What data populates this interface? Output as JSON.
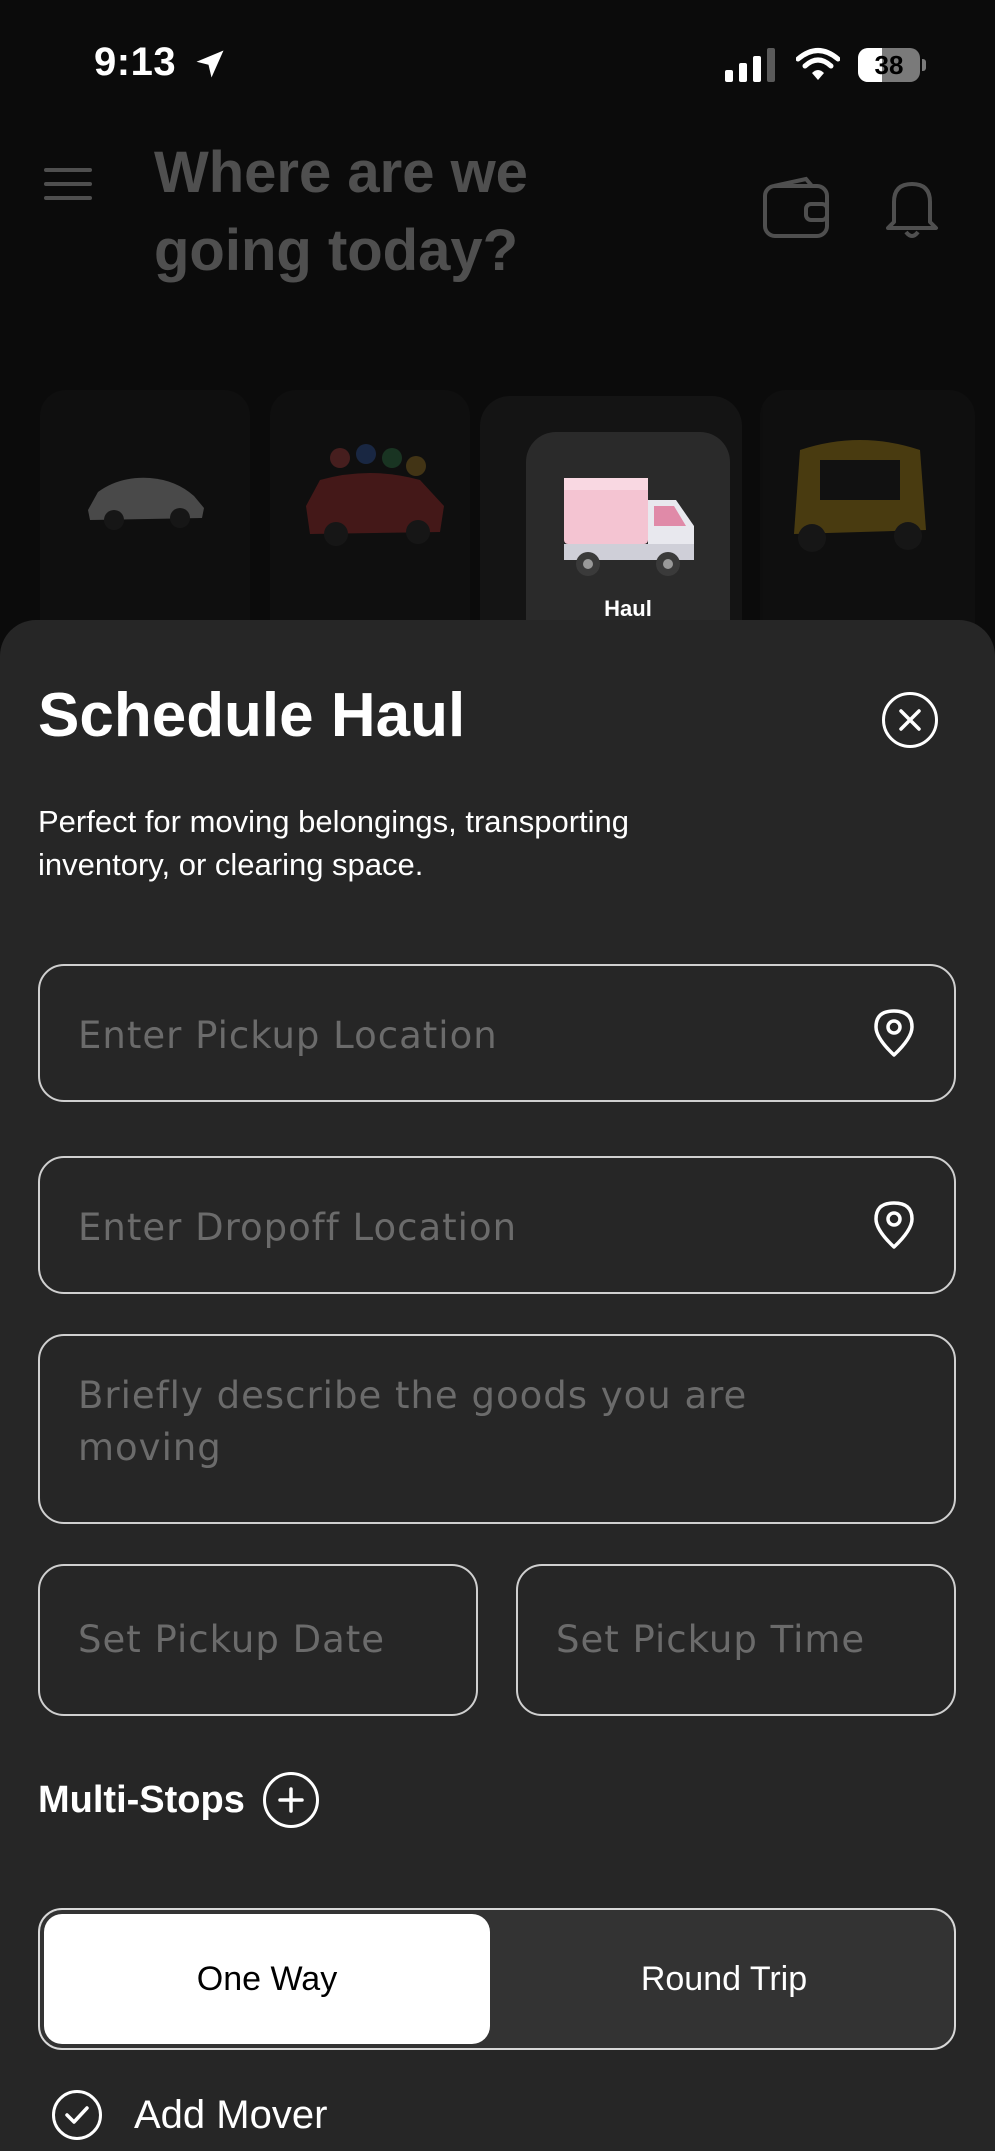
{
  "status_bar": {
    "time": "9:13",
    "battery": "38",
    "battery_level": 0.38
  },
  "header": {
    "title": "Where are we going today?"
  },
  "vehicles": {
    "active_label": "Haul"
  },
  "sheet": {
    "title": "Schedule Haul",
    "description": "Perfect for moving belongings, transporting inventory, or clearing space.",
    "pickup_placeholder": "Enter Pickup Location",
    "dropoff_placeholder": "Enter Dropoff Location",
    "goods_placeholder": "Briefly describe the goods you are moving",
    "date_placeholder": "Set Pickup Date",
    "time_placeholder": "Set Pickup Time",
    "multi_stops_label": "Multi-Stops",
    "trip_options": [
      "One Way",
      "Round Trip"
    ],
    "selected_trip": "One Way",
    "add_mover_label": "Add Mover"
  },
  "colors": {
    "sheet_bg": "#262626",
    "selected_bg": "#ffffff",
    "placeholder": "#6b6b6b"
  }
}
